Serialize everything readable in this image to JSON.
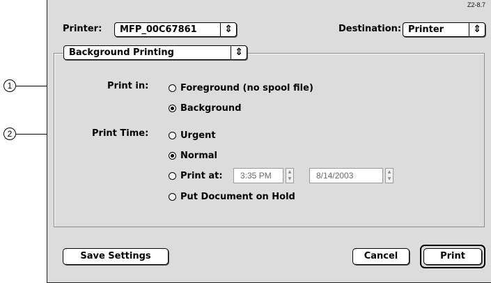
{
  "version_tag": "Z2-8.7",
  "header": {
    "printer_label": "Printer:",
    "printer_value": "MFP_00C67861",
    "destination_label": "Destination:",
    "destination_value": "Printer"
  },
  "panel_select": {
    "value": "Background Printing"
  },
  "print_in": {
    "label": "Print in:",
    "options": [
      {
        "label": "Foreground (no spool file)",
        "selected": false
      },
      {
        "label": "Background",
        "selected": true
      }
    ]
  },
  "print_time": {
    "label": "Print Time:",
    "options": [
      {
        "label": "Urgent",
        "selected": false
      },
      {
        "label": "Normal",
        "selected": true
      },
      {
        "label": "Print at:",
        "selected": false
      },
      {
        "label": "Put Document on Hold",
        "selected": false
      }
    ],
    "time_value": "3:35 PM",
    "date_value": "8/14/2003"
  },
  "buttons": {
    "save_settings": "Save Settings",
    "cancel": "Cancel",
    "print": "Print"
  },
  "callouts": [
    "1",
    "2"
  ],
  "icons": {
    "popup_arrow": "updown-arrows-icon",
    "stepper": "stepper-arrows-icon"
  }
}
